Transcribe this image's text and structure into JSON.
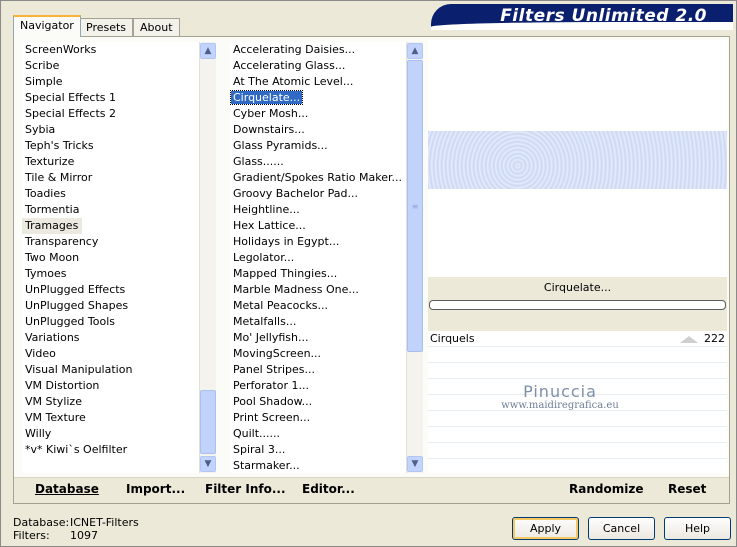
{
  "app": {
    "title": "Filters Unlimited 2.0"
  },
  "tabs": [
    {
      "label": "Navigator"
    },
    {
      "label": "Presets"
    },
    {
      "label": "About"
    }
  ],
  "categories": [
    "ScreenWorks",
    "Scribe",
    "Simple",
    "Special Effects 1",
    "Special Effects 2",
    "Sybia",
    "Teph's Tricks",
    "Texturize",
    "Tile & Mirror",
    "Toadies",
    "Tormentia",
    "Tramages",
    "Transparency",
    "Two Moon",
    "Tymoes",
    "UnPlugged Effects",
    "UnPlugged Shapes",
    "UnPlugged Tools",
    "Variations",
    "Video",
    "Visual Manipulation",
    "VM Distortion",
    "VM Stylize",
    "VM Texture",
    "Willy",
    "*v* Kiwi`s Oelfilter"
  ],
  "filters": [
    "Accelerating Daisies...",
    "Accelerating Glass...",
    "At The Atomic Level...",
    "Cirquelate...",
    "Cyber Mosh...",
    "Downstairs...",
    "Glass Pyramids...",
    "Glass......",
    "Gradient/Spokes Ratio Maker...",
    "Groovy Bachelor Pad...",
    "Heightline...",
    "Hex Lattice...",
    "Holidays in Egypt...",
    "Legolator...",
    "Mapped Thingies...",
    "Marble Madness One...",
    "Metal Peacocks...",
    "Metalfalls...",
    "Mo' Jellyfish...",
    "MovingScreen...",
    "Panel Stripes...",
    "Perforator 1...",
    "Pool Shadow...",
    "Print Screen...",
    "Quilt......",
    "Spiral 3...",
    "Starmaker..."
  ],
  "selected_category": "Tramages",
  "selected_filter": "Cirquelate...",
  "preview": {
    "filter_name": "Cirquelate..."
  },
  "params": [
    {
      "label": "Cirquels",
      "value": "222"
    }
  ],
  "watermark": {
    "name": "Pinuccia",
    "url": "www.maidiregrafica.eu"
  },
  "panel_buttons": {
    "database": "Database",
    "import": "Import...",
    "filter_info": "Filter Info...",
    "editor": "Editor...",
    "randomize": "Randomize",
    "reset": "Reset"
  },
  "footer": {
    "database_label": "Database:",
    "database_value": "ICNET-Filters",
    "filters_label": "Filters:",
    "filters_value": "1097"
  },
  "dialog_buttons": {
    "apply": "Apply",
    "cancel": "Cancel",
    "help": "Help"
  }
}
